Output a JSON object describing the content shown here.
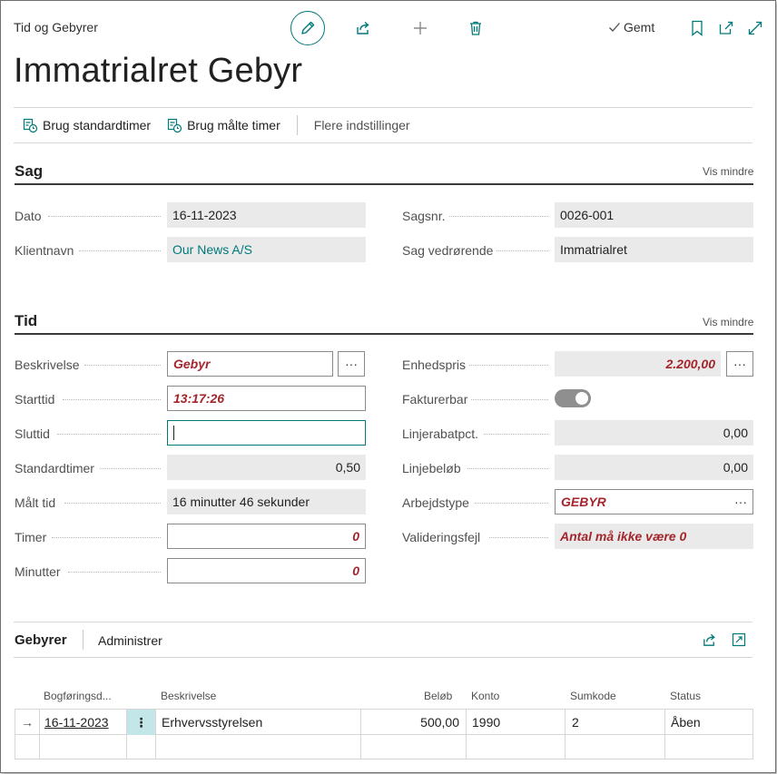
{
  "header": {
    "breadcrumb": "Tid og Gebyrer",
    "saved_label": "Gemt",
    "title": "Immatrialret Gebyr"
  },
  "actions": {
    "standard_hours": "Brug standardtimer",
    "measured_hours": "Brug målte timer",
    "more_options": "Flere indstillinger"
  },
  "sag": {
    "title": "Sag",
    "show_less": "Vis mindre",
    "dato_label": "Dato",
    "dato_value": "16-11-2023",
    "klient_label": "Klientnavn",
    "klient_value": "Our News A/S",
    "sagsnr_label": "Sagsnr.",
    "sagsnr_value": "0026-001",
    "vedr_label": "Sag vedrørende",
    "vedr_value": "Immatrialret"
  },
  "tid": {
    "title": "Tid",
    "show_less": "Vis mindre",
    "beskrivelse_label": "Beskrivelse",
    "beskrivelse_value": "Gebyr",
    "starttid_label": "Starttid",
    "starttid_value": "13:17:26",
    "sluttid_label": "Sluttid",
    "sluttid_value": "",
    "standardtimer_label": "Standardtimer",
    "standardtimer_value": "0,50",
    "maalt_label": "Målt tid",
    "maalt_value": "16 minutter 46 sekunder",
    "timer_label": "Timer",
    "timer_value": "0",
    "minutter_label": "Minutter",
    "minutter_value": "0",
    "enhedspris_label": "Enhedspris",
    "enhedspris_value": "2.200,00",
    "fakturerbar_label": "Fakturerbar",
    "fakturerbar_value": true,
    "rabat_label": "Linjerabatpct.",
    "rabat_value": "0,00",
    "linjebeloeb_label": "Linjebeløb",
    "linjebeloeb_value": "0,00",
    "arbejdstype_label": "Arbejdstype",
    "arbejdstype_value": "GEBYR",
    "valideringsfejl_label": "Valideringsfejl",
    "valideringsfejl_value": "Antal må ikke være 0",
    "ellipsis": "···"
  },
  "gebyrer": {
    "title": "Gebyrer",
    "tab_manage": "Administrer",
    "columns": [
      "Bogføringsd...",
      "Beskrivelse",
      "Beløb",
      "Konto",
      "Sumkode",
      "Status"
    ],
    "rows": [
      {
        "date": "16-11-2023",
        "description": "Erhvervsstyrelsen",
        "amount": "500,00",
        "account": "1990",
        "sumcode": "2",
        "status": "Åben"
      }
    ],
    "row_menu": "⋮",
    "row_arrow": "→"
  },
  "colors": {
    "accent": "#00797a",
    "error": "#a4262c"
  }
}
